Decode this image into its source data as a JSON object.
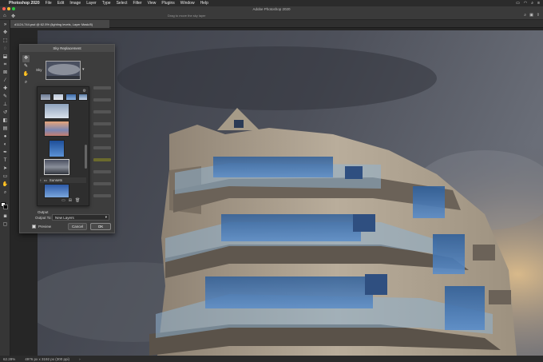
{
  "menubar": {
    "app_name": "Photoshop 2020",
    "items": [
      "File",
      "Edit",
      "Image",
      "Layer",
      "Type",
      "Select",
      "Filter",
      "View",
      "Plugins",
      "Window",
      "Help"
    ],
    "right_icons": [
      "battery-icon",
      "wifi-icon",
      "search-icon",
      "control-center-icon"
    ]
  },
  "window": {
    "title": "Adobe Photoshop 2020",
    "traffic_colors": [
      "#ff5f57",
      "#febc2e",
      "#28c840"
    ]
  },
  "options_bar": {
    "hint": "Drag to move the sky layer"
  },
  "document": {
    "tab_label": "d1124-744.psd @ 62.5% (lighting levels, Layer Mask/8)"
  },
  "status": {
    "zoom": "62.28%",
    "dimensions": "4976 px x 3192 px (300 ppi)"
  },
  "dialog": {
    "title": "Sky Replacement",
    "sky_label": "Sky",
    "folder_label": "Sunsets",
    "output_label": "Output",
    "output_to_label": "Output To:",
    "output_to_value": "New Layers",
    "preview_label": "Preview",
    "cancel_label": "Cancel",
    "ok_label": "OK",
    "colors": {
      "slider_highlight": "#6b6a2d"
    }
  }
}
